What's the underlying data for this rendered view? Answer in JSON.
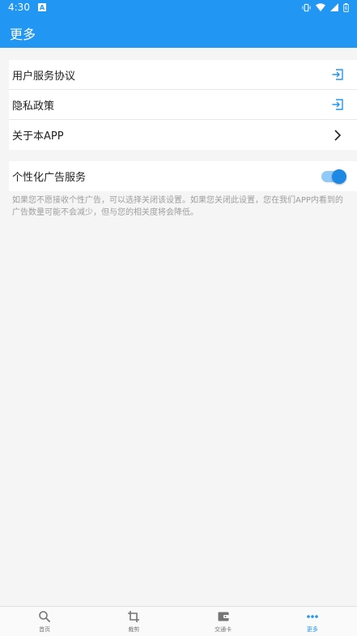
{
  "status_bar": {
    "time": "4:30",
    "badge": "A"
  },
  "app_bar": {
    "title": "更多"
  },
  "menu": {
    "items": [
      {
        "label": "用户服务协议",
        "icon": "open-external-icon"
      },
      {
        "label": "隐私政策",
        "icon": "open-external-icon"
      },
      {
        "label": "关于本APP",
        "icon": "chevron-right-icon"
      }
    ]
  },
  "ad_setting": {
    "label": "个性化广告服务",
    "enabled": true,
    "description": "如果您不愿接收个性广告，可以选择关闭该设置。如果您关闭此设置，您在我们APP内看到的广告数量可能不会减少，但与您的相关度将会降低。"
  },
  "bottom_nav": {
    "items": [
      {
        "label": "首页",
        "icon": "search-icon"
      },
      {
        "label": "裁剪",
        "icon": "crop-icon"
      },
      {
        "label": "交通卡",
        "icon": "wallet-icon"
      },
      {
        "label": "更多",
        "icon": "more-dots-icon",
        "active": true
      }
    ]
  },
  "colors": {
    "primary": "#2196f3",
    "toggle_knob": "#1e88e5",
    "toggle_track": "#90caf9"
  }
}
